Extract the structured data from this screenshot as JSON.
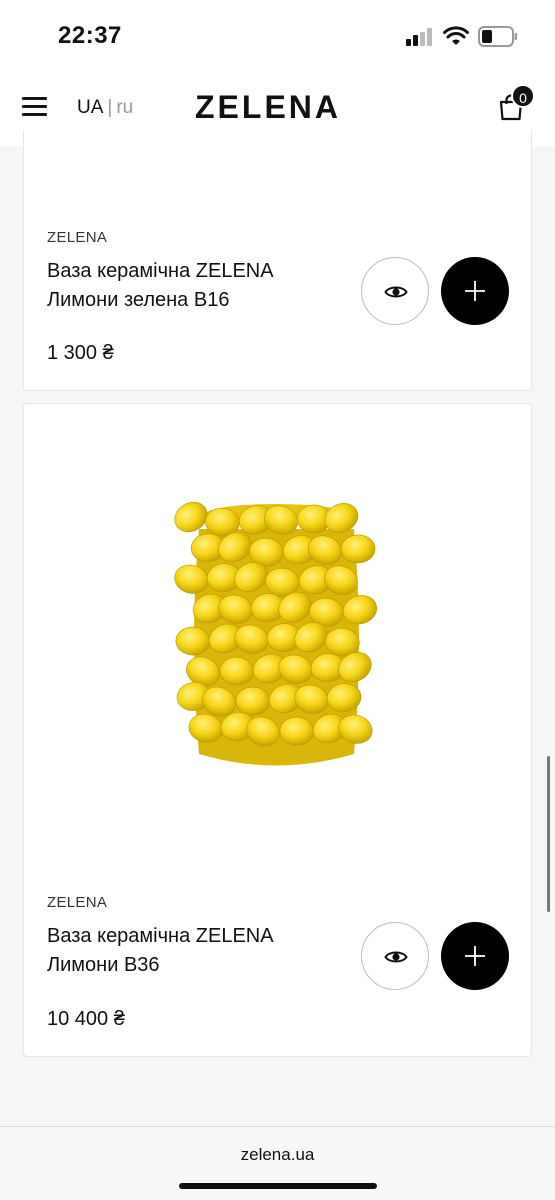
{
  "status_bar": {
    "time": "22:37"
  },
  "header": {
    "lang_ua": "UA",
    "lang_sep": "|",
    "lang_ru": "ru",
    "logo": "ZELENA",
    "cart_count": "0"
  },
  "products": [
    {
      "brand": "ZELENA",
      "title": "Ваза керамічна ZELENA Лимони зелена B16",
      "price": "1 300 ₴"
    },
    {
      "brand": "ZELENA",
      "title": "Ваза керамічна ZELENA Лимони B36",
      "price": "10 400 ₴"
    }
  ],
  "browser": {
    "url": "zelena.ua"
  },
  "colors": {
    "accent": "#000000",
    "lemon": "#f5d414",
    "background": "#f6f6f6"
  }
}
